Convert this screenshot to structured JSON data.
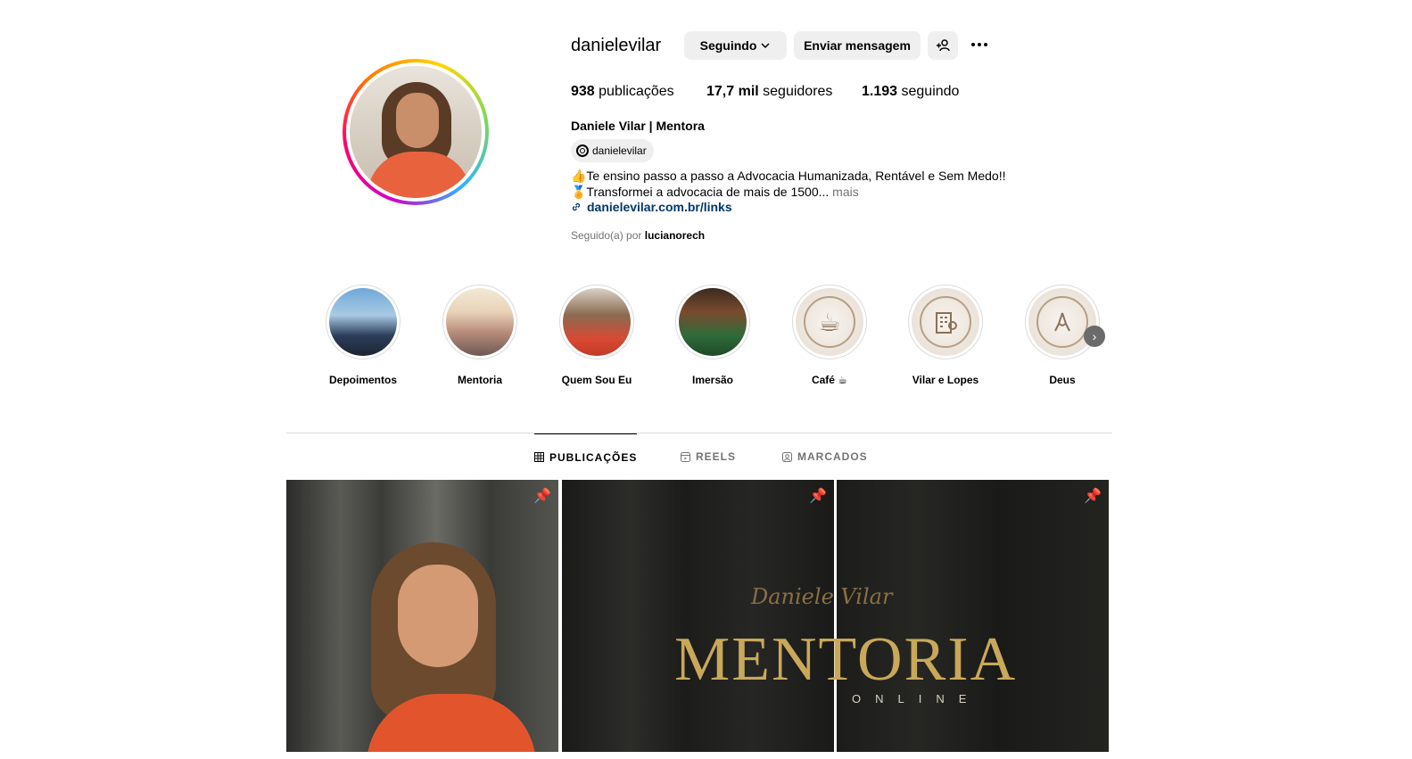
{
  "profile": {
    "username": "danielevilar",
    "following_button": "Seguindo",
    "message_button": "Enviar mensagem",
    "stats": {
      "posts_count": "938",
      "posts_label": "publicações",
      "followers_count": "17,7 mil",
      "followers_label": "seguidores",
      "following_count": "1.193",
      "following_label": "seguindo"
    },
    "full_name": "Daniele Vilar | Mentora",
    "threads_handle": "danielevilar",
    "bio_line1": "👍Te ensino passo a passo a Advocacia Humanizada, Rentável e Sem Medo!!",
    "bio_line2": "🏅Transformei a advocacia de mais de 1500...",
    "bio_more": "mais",
    "link": "danielevilar.com.br/links",
    "followed_by_prefix": "Seguido(a) por",
    "followed_by_user": "lucianorech"
  },
  "highlights": [
    {
      "label": "Depoimentos"
    },
    {
      "label": "Mentoria"
    },
    {
      "label": "Quem Sou Eu"
    },
    {
      "label": "Imersão"
    },
    {
      "label": "Café ☕",
      "icon": "coffee-cup-icon"
    },
    {
      "label": "Vilar e Lopes",
      "icon": "building-location-icon"
    },
    {
      "label": "Deus",
      "icon": "praying-hands-icon"
    }
  ],
  "tabs": {
    "posts": "PUBLICAÇÕES",
    "reels": "REELS",
    "tagged": "MARCADOS"
  },
  "posts": {
    "post3_signature": "Daniele Vilar",
    "post3_title": "MENTORIA",
    "post3_subtitle": "ONLINE"
  },
  "colors": {
    "link": "#00376b",
    "muted": "#737373",
    "button_bg": "#efefef",
    "gold": "#c9a85a"
  }
}
